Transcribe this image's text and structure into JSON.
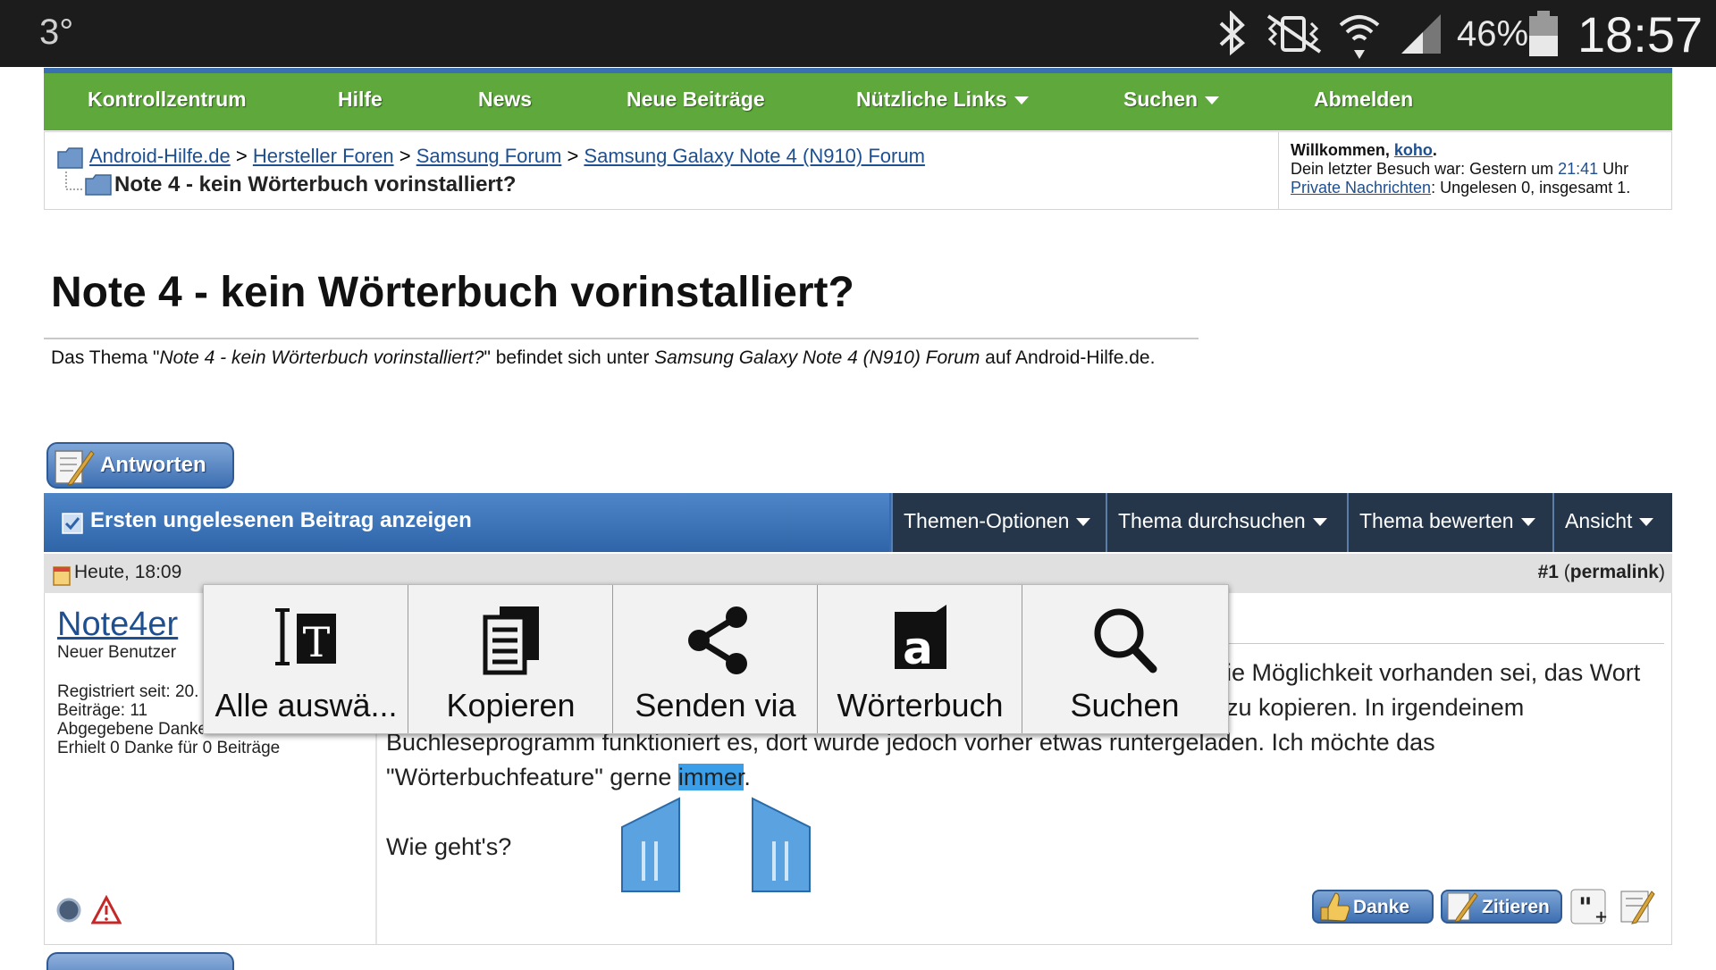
{
  "status_bar": {
    "temperature": "3°",
    "battery": "46%",
    "time": "18:57"
  },
  "nav": {
    "items": [
      {
        "label": "Kontrollzentrum",
        "dropdown": false
      },
      {
        "label": "Hilfe",
        "dropdown": false
      },
      {
        "label": "News",
        "dropdown": false
      },
      {
        "label": "Neue Beiträge",
        "dropdown": false
      },
      {
        "label": "Nützliche Links",
        "dropdown": true
      },
      {
        "label": "Suchen",
        "dropdown": true
      },
      {
        "label": "Abmelden",
        "dropdown": false
      }
    ]
  },
  "breadcrumb": {
    "links": [
      "Android-Hilfe.de",
      "Hersteller Foren",
      "Samsung Forum",
      "Samsung Galaxy Note 4 (N910) Forum"
    ],
    "separator": ">",
    "current": "Note 4 - kein Wörterbuch vorinstalliert?"
  },
  "welcome": {
    "prefix": "Willkommen, ",
    "user": "koho",
    "last_visit": "Dein letzter Besuch war: Gestern um ",
    "last_visit_time": "21:41",
    "last_visit_suffix": " Uhr",
    "pm_link": "Private Nachrichten",
    "pm_text": ": Ungelesen 0, insgesamt 1."
  },
  "thread": {
    "title": "Note 4 - kein Wörterbuch vorinstalliert?",
    "desc_prefix": "Das Thema \"",
    "desc_title": "Note 4 - kein Wörterbuch vorinstalliert?",
    "desc_mid": "\" befindet sich unter ",
    "desc_forum": "Samsung Galaxy Note 4 (N910) Forum",
    "desc_suffix": " auf Android-Hilfe.de."
  },
  "buttons": {
    "reply": "Antworten"
  },
  "toolbar": {
    "unread": "Ersten ungelesenen Beitrag anzeigen",
    "options": [
      "Themen-Optionen",
      "Thema durchsuchen",
      "Thema bewerten",
      "Ansicht"
    ]
  },
  "post": {
    "date": "Heute, 18:09",
    "number": "#1",
    "permalink": "permalink",
    "user": {
      "name": "Note4er",
      "title": "Neuer Benutzer",
      "registered": "Registriert seit: 20.",
      "posts": "Beiträge: 11",
      "thanks_given": "Abgegebene Danke",
      "thanks_received": "Erhielt 0 Danke für 0 Beiträge"
    },
    "lines": [
      "ie Möglichkeit vorhanden sei, das Wort",
      "zu kopieren. In irgendeinem",
      "Buchleseprogramm funktioniert es, dort wurde jedoch vorher etwas runtergeladen. Ich möchte das"
    ],
    "line4_before": "\"Wörterbuchfeature\" gerne ",
    "line4_selected": "immer",
    "line4_after": ".",
    "closing": "Wie geht's?",
    "actions": {
      "thanks": "Danke",
      "quote": "Zitieren"
    }
  },
  "context_menu": {
    "items": [
      {
        "label": "Alle auswä...",
        "icon": "select-all-icon"
      },
      {
        "label": "Kopieren",
        "icon": "copy-icon"
      },
      {
        "label": "Senden via",
        "icon": "share-icon"
      },
      {
        "label": "Wörterbuch",
        "icon": "dictionary-icon"
      },
      {
        "label": "Suchen",
        "icon": "search-icon"
      }
    ]
  },
  "colors": {
    "nav_green": "#5fa83c",
    "forum_blue": "#3a6aaa",
    "selection": "#3a9ee8"
  }
}
